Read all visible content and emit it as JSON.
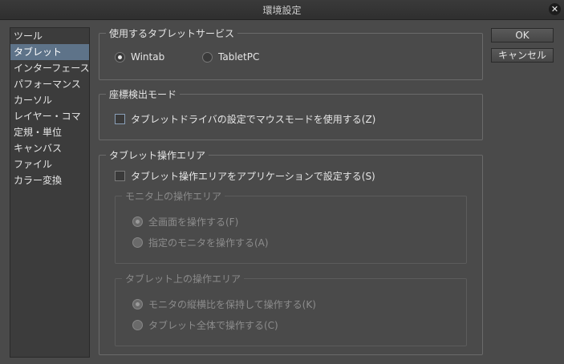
{
  "window": {
    "title": "環境設定"
  },
  "sidebar": {
    "items": [
      {
        "label": "ツール"
      },
      {
        "label": "タブレット"
      },
      {
        "label": "インターフェース"
      },
      {
        "label": "パフォーマンス"
      },
      {
        "label": "カーソル"
      },
      {
        "label": "レイヤー・コマ"
      },
      {
        "label": "定規・単位"
      },
      {
        "label": "キャンバス"
      },
      {
        "label": "ファイル"
      },
      {
        "label": "カラー変換"
      }
    ],
    "selected": "タブレット"
  },
  "buttons": {
    "ok": "OK",
    "cancel": "キャンセル"
  },
  "tablet_service": {
    "legend": "使用するタブレットサービス",
    "wintab": "Wintab",
    "tabletpc": "TabletPC",
    "selected": "Wintab"
  },
  "coord_mode": {
    "legend": "座標検出モード",
    "mouse_mode_label": "タブレットドライバの設定でマウスモードを使用する(Z)",
    "mouse_mode_checked": false
  },
  "work_area": {
    "legend": "タブレット操作エリア",
    "app_set_label": "タブレット操作エリアをアプリケーションで設定する(S)",
    "app_set_checked": false,
    "monitor_group": {
      "legend": "モニタ上の操作エリア",
      "full_screen": "全画面を操作する(F)",
      "specified_monitor": "指定のモニタを操作する(A)",
      "selected": "全画面を操作する(F)"
    },
    "tablet_group": {
      "legend": "タブレット上の操作エリア",
      "keep_aspect": "モニタの縦横比を保持して操作する(K)",
      "whole_tablet": "タブレット全体で操作する(C)",
      "selected": "モニタの縦横比を保持して操作する(K)"
    }
  }
}
